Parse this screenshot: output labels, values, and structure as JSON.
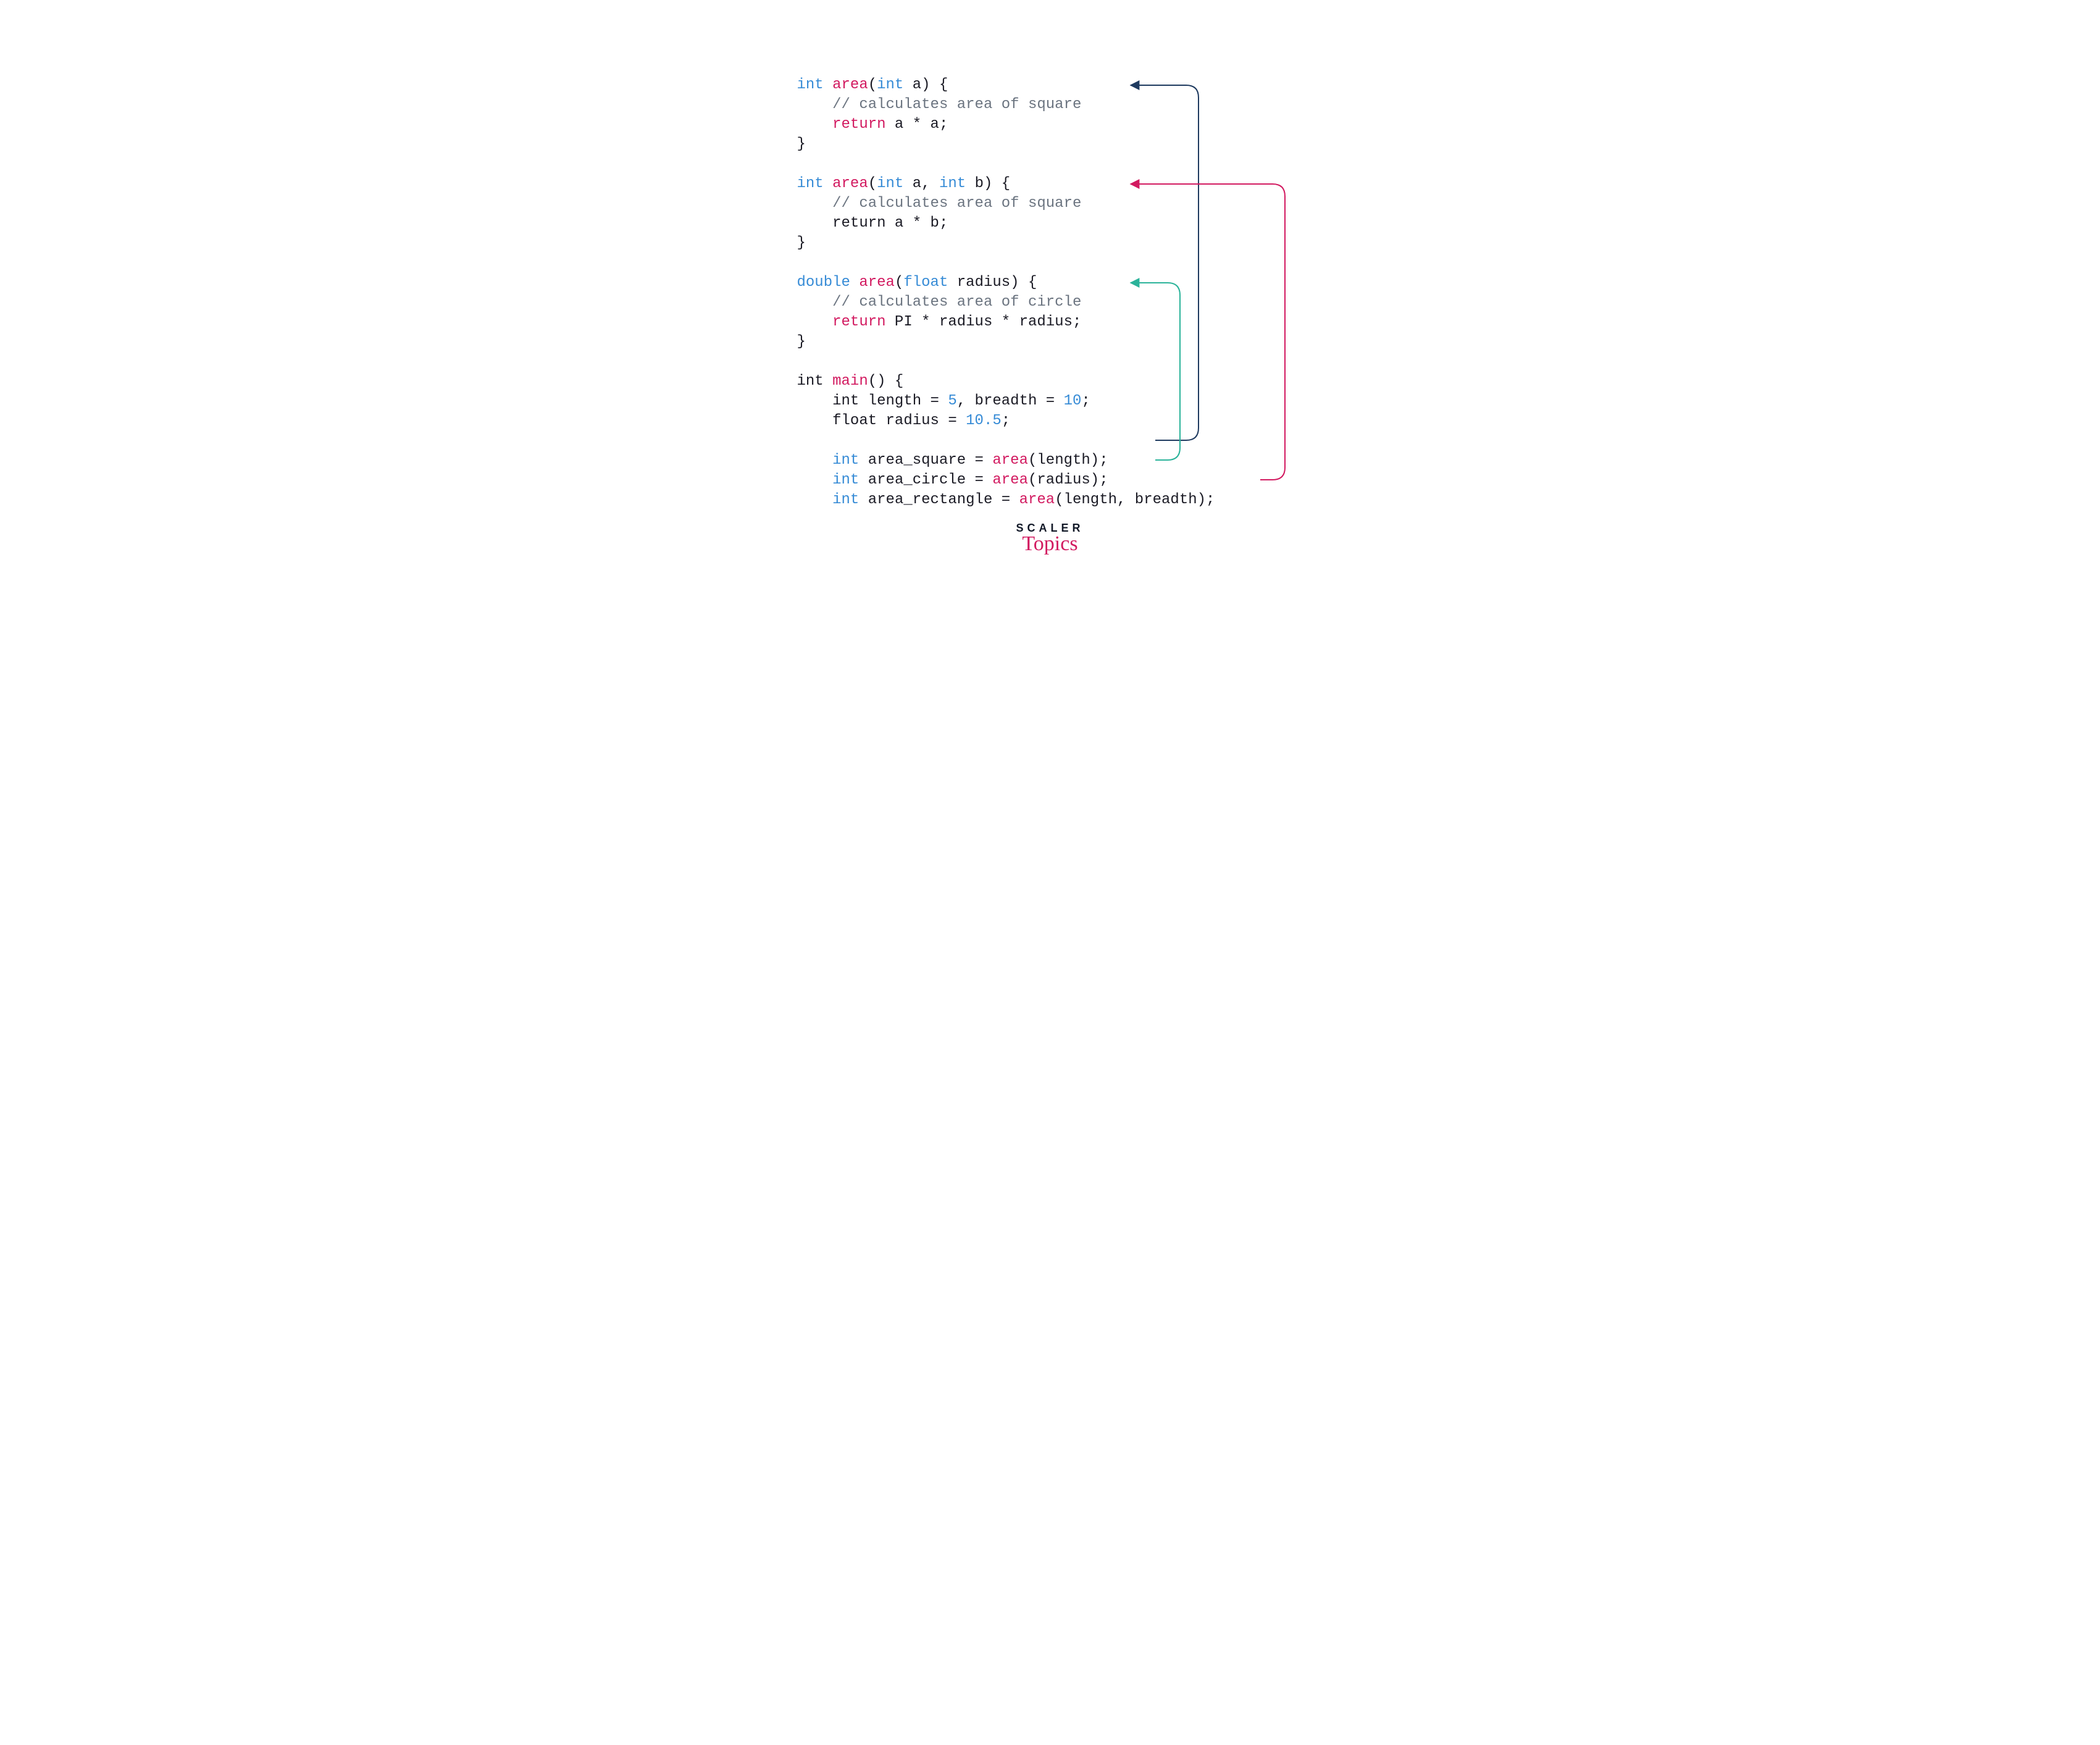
{
  "code": {
    "fn1": {
      "sig_pre": "int ",
      "name": "area",
      "sig_post_open": "(",
      "param_type": "int",
      "param_name": " a) {",
      "comment": "    // calculates area of square",
      "ret_kw": "    return",
      "ret_expr": " a * a;",
      "close": "}"
    },
    "fn2": {
      "sig_pre": "int ",
      "name": "area",
      "sig_post_open": "(",
      "param1_type": "int",
      "param1_name": " a, ",
      "param2_type": "int",
      "param2_name": " b) {",
      "comment": "    // calculates area of square",
      "ret_line": "    return a * b;",
      "close": "}"
    },
    "fn3": {
      "sig_pre": "double ",
      "name": "area",
      "sig_post_open": "(",
      "param_type": "float",
      "param_name": " radius) {",
      "comment": "    // calculates area of circle",
      "ret_kw": "    return",
      "ret_expr": " PI * radius * radius;",
      "close": "}"
    },
    "main": {
      "sig_pre": "int ",
      "name": "main",
      "sig_post": "() {",
      "decl1_pre": "    int length = ",
      "decl1_n1": "5",
      "decl1_mid": ", breadth = ",
      "decl1_n2": "10",
      "decl1_end": ";",
      "decl2_pre": "    float radius = ",
      "decl2_n": "10.5",
      "decl2_end": ";",
      "call1_kw": "    int",
      "call1_mid": " area_square = ",
      "call1_fn": "area",
      "call1_args": "(length);",
      "call2_kw": "    int",
      "call2_mid": " area_circle = ",
      "call2_fn": "area",
      "call2_args": "(radius);",
      "call3_kw": "    int",
      "call3_mid": " area_rectangle = ",
      "call3_fn": "area",
      "call3_args": "(length, breadth);"
    }
  },
  "logo": {
    "line1": "SCALER",
    "line2": "Topics"
  },
  "arrows": {
    "colors": {
      "navy": "#1e3a5f",
      "pink": "#d21a60",
      "teal": "#2bb39a"
    }
  }
}
